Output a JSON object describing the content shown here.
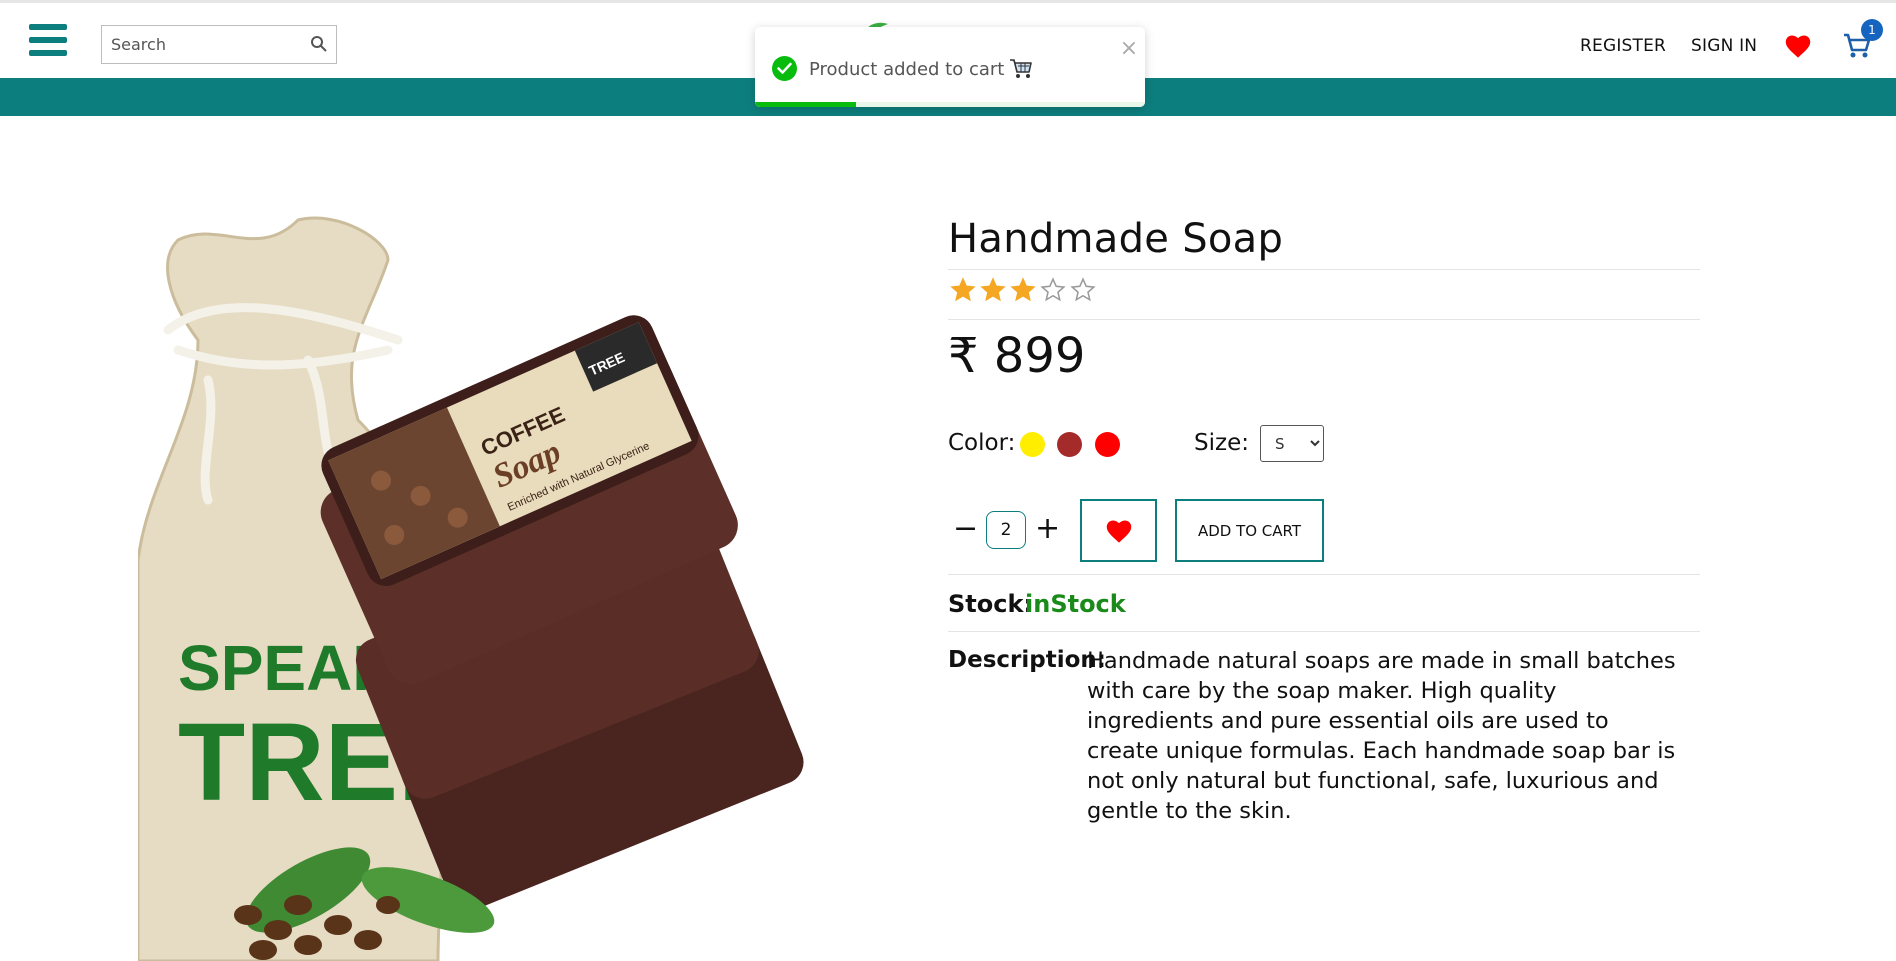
{
  "header": {
    "search_placeholder": "Search",
    "register_label": "REGISTER",
    "signin_label": "SIGN IN",
    "cart_count": "1"
  },
  "toast": {
    "message": "Product added to cart",
    "close_label": "×",
    "progress": 0.26
  },
  "product": {
    "title": "Handmade Soap",
    "rating": 3,
    "rating_max": 5,
    "price": "₹ 899",
    "color_label": "Color:",
    "colors": [
      "#ffee00",
      "#a52a2a",
      "#ff0000"
    ],
    "size_label": "Size:",
    "sizes": [
      "S"
    ],
    "size_selected": "S",
    "quantity": "2",
    "qty_minus": "−",
    "qty_plus": "+",
    "add_to_cart_label": "ADD TO CART",
    "stock_label": "Stock:",
    "stock_value": "inStock",
    "description_label": "Description:",
    "description": "Handmade natural soaps are made in small batches with care by the soap maker. High quality ingredients and pure essential oils are used to create unique formulas. Each handmade soap bar is not only natural but functional, safe, luxurious and gentle to the skin."
  },
  "colors": {
    "teal": "#0d7e7e",
    "heart": "#ff0000",
    "star_filled": "#f5a623",
    "stock_green": "#1a8a1a",
    "toast_green": "#07bc0c"
  },
  "icons": [
    "menu-icon",
    "search-icon",
    "heart-icon",
    "cart-icon",
    "check-circle-icon",
    "close-icon",
    "star-icon"
  ]
}
